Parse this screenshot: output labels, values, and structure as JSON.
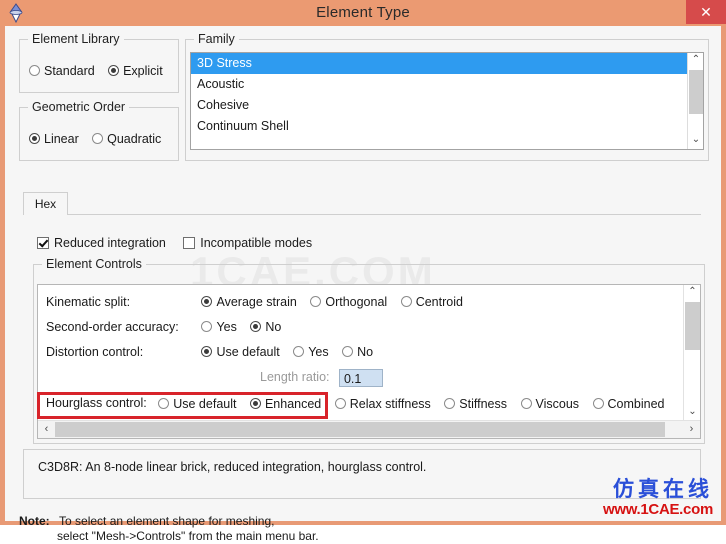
{
  "window": {
    "title": "Element Type",
    "app_icon": "abaqus-diamond-icon",
    "close_label": "✕",
    "titlebar_color": "#eb9a72",
    "close_color": "#d64b4b"
  },
  "element_library": {
    "legend": "Element Library",
    "options": [
      {
        "label": "Standard",
        "selected": false
      },
      {
        "label": "Explicit",
        "selected": true
      }
    ]
  },
  "geometric_order": {
    "legend": "Geometric Order",
    "options": [
      {
        "label": "Linear",
        "selected": true
      },
      {
        "label": "Quadratic",
        "selected": false
      }
    ]
  },
  "family": {
    "legend": "Family",
    "items": [
      {
        "label": "3D Stress",
        "selected": true
      },
      {
        "label": "Acoustic",
        "selected": false
      },
      {
        "label": "Cohesive",
        "selected": false
      },
      {
        "label": "Continuum Shell",
        "selected": false
      }
    ],
    "scroll_up": "⌃",
    "scroll_down": "⌄",
    "selection_color": "#2e9bf0"
  },
  "tabs": [
    {
      "label": "Hex",
      "active": true
    }
  ],
  "checkboxes": [
    {
      "label": "Reduced integration",
      "checked": true
    },
    {
      "label": "Incompatible modes",
      "checked": false
    }
  ],
  "element_controls": {
    "legend": "Element Controls",
    "rows": [
      {
        "label": "Kinematic split:",
        "dim": false,
        "options": [
          {
            "label": "Average strain",
            "selected": true
          },
          {
            "label": "Orthogonal",
            "selected": false
          },
          {
            "label": "Centroid",
            "selected": false
          }
        ]
      },
      {
        "label": "Second-order accuracy:",
        "dim": false,
        "options": [
          {
            "label": "Yes",
            "selected": false
          },
          {
            "label": "No",
            "selected": true
          }
        ]
      },
      {
        "label": "Distortion control:",
        "dim": false,
        "options": [
          {
            "label": "Use default",
            "selected": true
          },
          {
            "label": "Yes",
            "selected": false
          },
          {
            "label": "No",
            "selected": false
          }
        ]
      }
    ],
    "length_ratio": {
      "label": "Length ratio:",
      "value": "0.1",
      "disabled": true
    },
    "hourglass": {
      "label": "Hourglass control:",
      "highlighted": true,
      "highlight_color": "#d8232a",
      "options": [
        {
          "label": "Use default",
          "selected": false
        },
        {
          "label": "Enhanced",
          "selected": true
        },
        {
          "label": "Relax stiffness",
          "selected": false
        },
        {
          "label": "Stiffness",
          "selected": false
        },
        {
          "label": "Viscous",
          "selected": false
        },
        {
          "label": "Combined",
          "selected": false
        }
      ]
    },
    "scrollbar": {
      "up": "⌃",
      "down": "⌄",
      "left": "‹",
      "right": "›"
    }
  },
  "description": {
    "text": "C3D8R:  An 8-node linear brick, reduced integration, hourglass control."
  },
  "note": {
    "label": "Note:",
    "line1": "To select an element shape for meshing,",
    "line2": "select \"Mesh->Controls\" from the main menu bar."
  },
  "watermarks": {
    "background": "1CAE.COM",
    "corner_cn": "仿真在线",
    "corner_url": "www.1CAE.com"
  }
}
